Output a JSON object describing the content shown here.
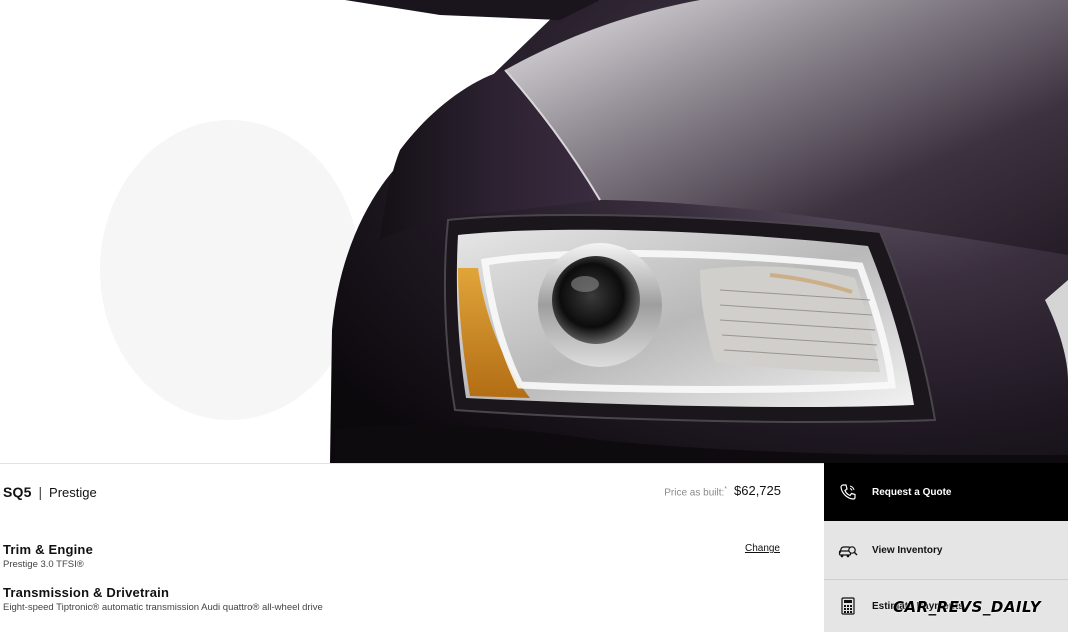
{
  "summary": {
    "model": "SQ5",
    "separator": "|",
    "trim": "Prestige",
    "price_label": "Price as built:",
    "price_marker": "*",
    "price": "$62,725"
  },
  "trim_engine": {
    "title": "Trim & Engine",
    "value": "Prestige 3.0 TFSI®",
    "change_label": "Change"
  },
  "transmission": {
    "title": "Transmission & Drivetrain",
    "value": "Eight-speed Tiptronic® automatic transmission Audi quattro® all-wheel drive"
  },
  "actions": {
    "request_quote": {
      "label": "Request a Quote",
      "icon": "phone-icon"
    },
    "view_inventory": {
      "label": "View Inventory",
      "icon": "car-search-icon"
    },
    "estimate_payments": {
      "label": "Estimate Payments",
      "icon": "calculator-icon"
    }
  },
  "watermark": "CAR_REVS_DAILY",
  "colors": {
    "primary_button": "#000000",
    "secondary_button": "#e5e5e5",
    "car_paint": "#2a1f2c"
  }
}
